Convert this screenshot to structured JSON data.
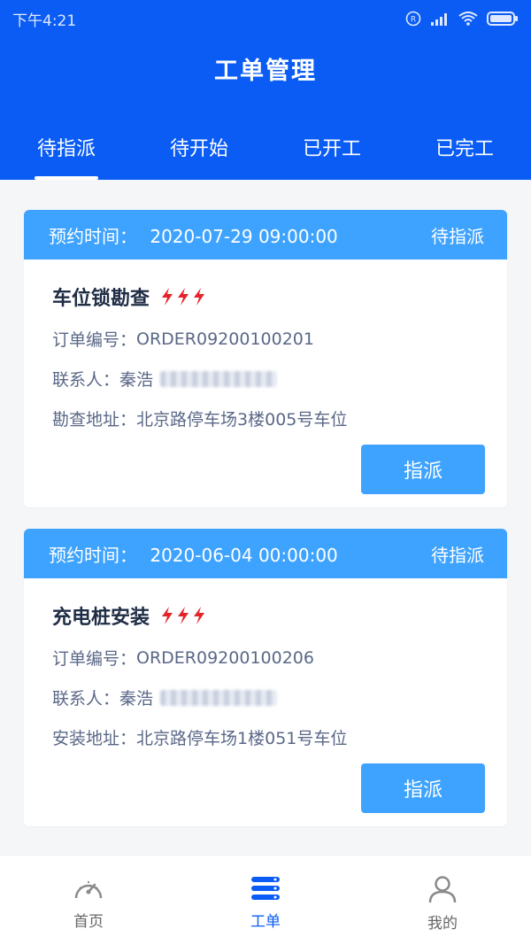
{
  "status_bar": {
    "time": "下午4:21"
  },
  "header": {
    "title": "工单管理",
    "tabs": [
      {
        "label": "待指派",
        "active": true
      },
      {
        "label": "待开始",
        "active": false
      },
      {
        "label": "已开工",
        "active": false
      },
      {
        "label": "已完工",
        "active": false
      }
    ]
  },
  "cards": [
    {
      "appointment_label": "预约时间：",
      "appointment_value": "2020-07-29 09:00:00",
      "status": "待指派",
      "title": "车位锁勘查",
      "order_label": "订单编号：",
      "order_value": "ORDER09200100201",
      "contact_label": "联系人：",
      "contact_value": "秦浩",
      "address_label": "勘查地址：",
      "address_value": "北京路停车场3楼005号车位",
      "button": "指派"
    },
    {
      "appointment_label": "预约时间：",
      "appointment_value": "2020-06-04 00:00:00",
      "status": "待指派",
      "title": "充电桩安装",
      "order_label": "订单编号：",
      "order_value": "ORDER09200100206",
      "contact_label": "联系人：",
      "contact_value": "秦浩",
      "address_label": "安装地址：",
      "address_value": "北京路停车场1楼051号车位",
      "button": "指派"
    }
  ],
  "bottom_nav": [
    {
      "label": "首页",
      "icon": "dashboard-icon",
      "active": false
    },
    {
      "label": "工单",
      "icon": "list-icon",
      "active": true
    },
    {
      "label": "我的",
      "icon": "user-icon",
      "active": false
    }
  ],
  "colors": {
    "primary": "#0a5cf5",
    "accent": "#3ea3ff",
    "urgent": "#e4242a"
  }
}
